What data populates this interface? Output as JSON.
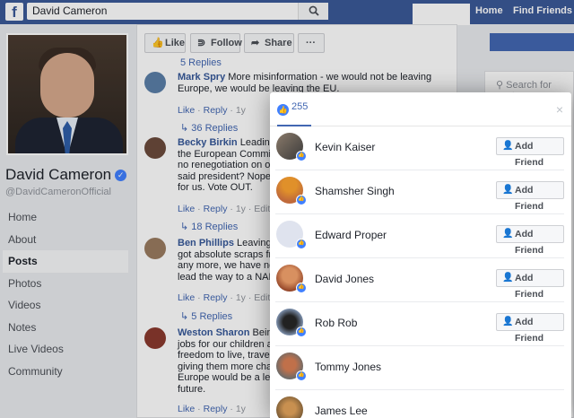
{
  "topbar": {
    "logo": "f",
    "search_value": "David Cameron",
    "links": [
      "Home",
      "Find Friends"
    ]
  },
  "profile": {
    "name": "David Cameron",
    "handle": "@DavidCameronOfficial",
    "nav": [
      "Home",
      "About",
      "Posts",
      "Photos",
      "Videos",
      "Notes",
      "Live Videos",
      "Community"
    ],
    "active_nav": "Posts"
  },
  "post_actions": {
    "like": "Like",
    "follow": "Follow",
    "share": "Share",
    "more": "···"
  },
  "comments": [
    {
      "top_replies": "5 Replies",
      "name": "Mark Spry",
      "text": "More misinformation - we would not be leaving Europe, we would be leaving the EU.",
      "meta_like": "Like",
      "meta_reply": "Reply",
      "meta_time": "1y",
      "replies": "36 Replies"
    },
    {
      "name": "Becky Birkin",
      "text": "Leading E... the European Commiss... no renegotiation on our... said president? Nope. Y... for us. Vote OUT.",
      "lines": [
        "Leading E",
        "the European Commiss",
        "no renegotiation on our",
        "said president? Nope. Y",
        "for us. Vote OUT."
      ],
      "meta_like": "Like",
      "meta_reply": "Reply",
      "meta_time": "1y",
      "meta_edited": "Edited",
      "replies": "18 Replies"
    },
    {
      "name": "Ben Phillips",
      "lines": [
        "Leaving E",
        "got absolute scraps fro",
        "any more, we have no l",
        "lead the way to a NAFT"
      ],
      "meta_like": "Like",
      "meta_reply": "Reply",
      "meta_time": "1y",
      "meta_edited": "Edited",
      "replies": "5 Replies"
    },
    {
      "name": "Weston Sharon",
      "lines": [
        "Being",
        "jobs for our children and",
        "freedom to live, travel a",
        "giving them more chanc",
        "Europe would be a leap",
        "future."
      ],
      "meta_like": "Like",
      "meta_reply": "Reply",
      "meta_time": "1y"
    }
  ],
  "right": {
    "search_placeholder": "Search for posts"
  },
  "modal": {
    "tab_count": "255",
    "close": "×",
    "add_friend_label": "Add Friend",
    "people": [
      {
        "name": "Kevin Kaiser",
        "add_friend": true
      },
      {
        "name": "Shamsher Singh",
        "add_friend": true
      },
      {
        "name": "Edward Proper",
        "add_friend": true
      },
      {
        "name": "David Jones",
        "add_friend": true
      },
      {
        "name": "Rob Rob",
        "add_friend": true
      },
      {
        "name": "Tommy Jones",
        "add_friend": false
      },
      {
        "name": "James Lee",
        "add_friend": false
      }
    ]
  },
  "icons": {
    "like": "thumbs-up-icon",
    "follow": "rss-icon",
    "share": "share-arrow-icon",
    "add_friend": "person-plus-icon",
    "search": "search-icon",
    "verified": "check-badge-icon"
  },
  "colors": {
    "topbar": "#3b5998",
    "link": "#4267b2",
    "like_badge": "#4080ff"
  }
}
